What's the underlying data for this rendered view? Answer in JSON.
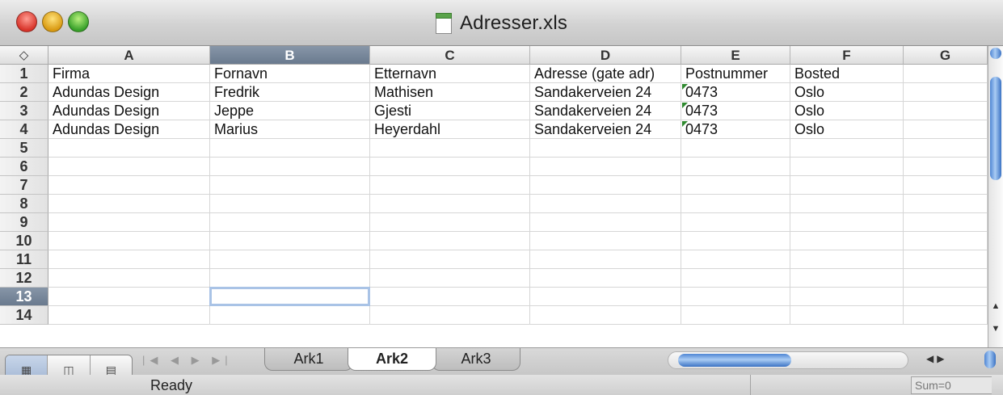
{
  "window": {
    "title": "Adresser.xls"
  },
  "columns": [
    "A",
    "B",
    "C",
    "D",
    "E",
    "F",
    "G"
  ],
  "corner_icon": "select-all-icon",
  "selected_column": "B",
  "selected_row": "13",
  "row_numbers": [
    "1",
    "2",
    "3",
    "4",
    "5",
    "6",
    "7",
    "8",
    "9",
    "10",
    "11",
    "12",
    "13",
    "14"
  ],
  "cells": [
    [
      "Firma",
      "Fornavn",
      "Etternavn",
      "Adresse (gate adr)",
      "Postnummer",
      "Bosted",
      ""
    ],
    [
      "Adundas Design",
      "Fredrik",
      "Mathisen",
      "Sandakerveien 24",
      "0473",
      "Oslo",
      ""
    ],
    [
      "Adundas Design",
      "Jeppe",
      "Gjesti",
      "Sandakerveien 24",
      "0473",
      "Oslo",
      ""
    ],
    [
      "Adundas Design",
      "Marius",
      "Heyerdahl",
      "Sandakerveien 24",
      "0473",
      "Oslo",
      ""
    ]
  ],
  "sheet_tabs": [
    {
      "label": "Ark1",
      "active": false
    },
    {
      "label": "Ark2",
      "active": true
    },
    {
      "label": "Ark3",
      "active": false
    }
  ],
  "status": {
    "text": "Ready",
    "sum": "Sum=0"
  },
  "colors": {
    "selection": "#a9c3e6",
    "header_selected": "#6a7a8e",
    "error_flag": "#2f8a2f"
  }
}
